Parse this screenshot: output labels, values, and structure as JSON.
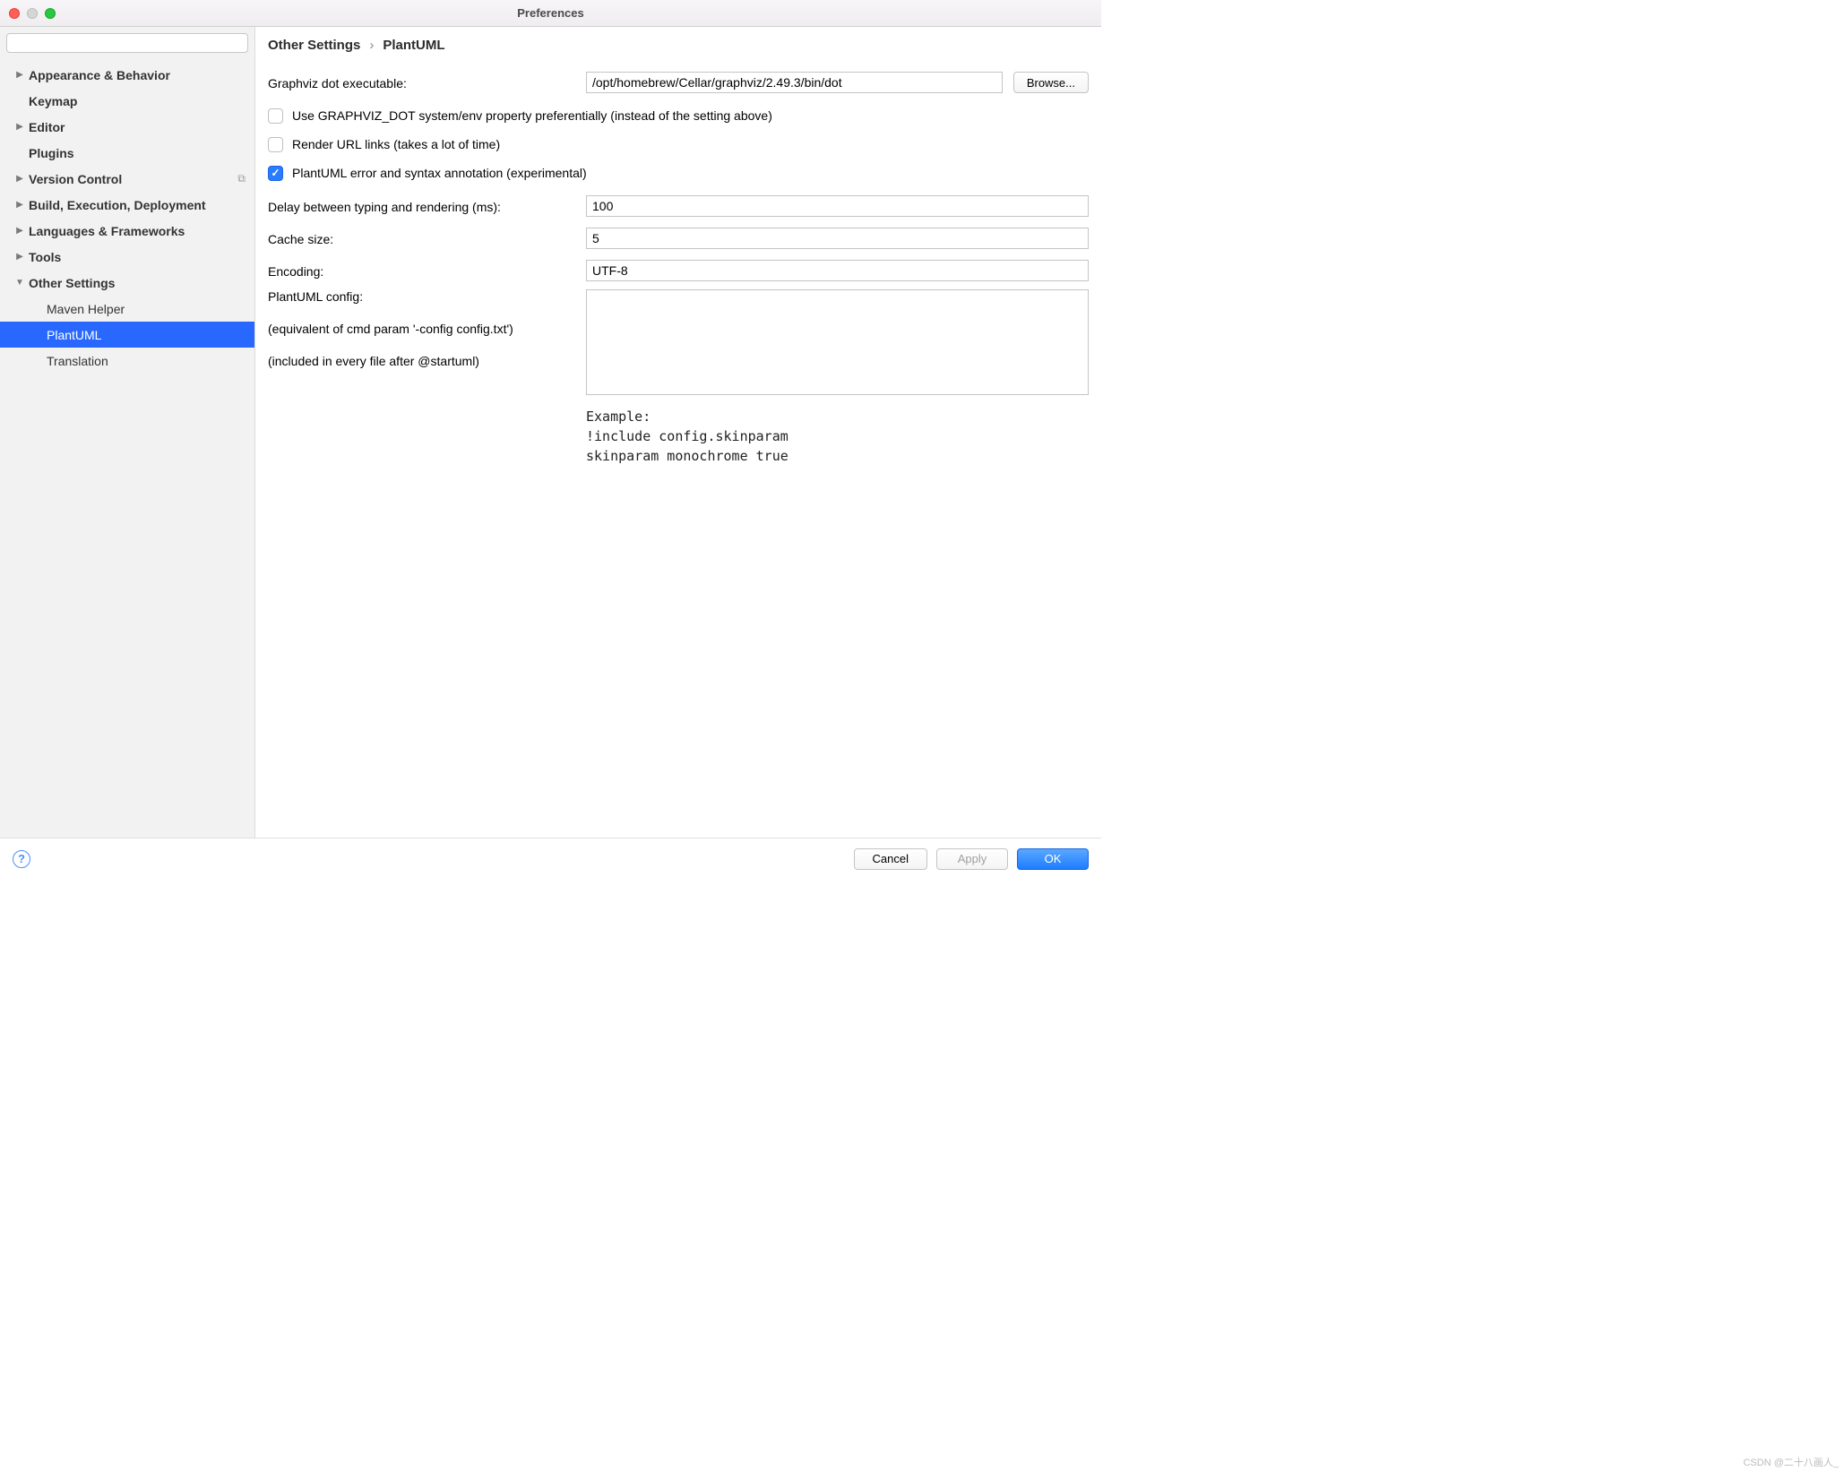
{
  "window": {
    "title": "Preferences"
  },
  "search": {
    "placeholder": ""
  },
  "sidebar": {
    "items": [
      {
        "label": "Appearance & Behavior",
        "expandable": true,
        "expanded": false
      },
      {
        "label": "Keymap",
        "expandable": false
      },
      {
        "label": "Editor",
        "expandable": true,
        "expanded": false
      },
      {
        "label": "Plugins",
        "expandable": false
      },
      {
        "label": "Version Control",
        "expandable": true,
        "expanded": false,
        "has_copy_icon": true
      },
      {
        "label": "Build, Execution, Deployment",
        "expandable": true,
        "expanded": false
      },
      {
        "label": "Languages & Frameworks",
        "expandable": true,
        "expanded": false
      },
      {
        "label": "Tools",
        "expandable": true,
        "expanded": false
      },
      {
        "label": "Other Settings",
        "expandable": true,
        "expanded": true,
        "children": [
          {
            "label": "Maven Helper"
          },
          {
            "label": "PlantUML",
            "selected": true
          },
          {
            "label": "Translation"
          }
        ]
      }
    ]
  },
  "breadcrumb": {
    "parent": "Other Settings",
    "current": "PlantUML"
  },
  "form": {
    "graphviz_label": "Graphviz dot executable:",
    "graphviz_value": "/opt/homebrew/Cellar/graphviz/2.49.3/bin/dot",
    "browse_label": "Browse...",
    "cb_use_env": "Use GRAPHVIZ_DOT system/env property preferentially (instead of the setting above)",
    "cb_render_url": "Render URL links (takes a lot of time)",
    "cb_syntax": "PlantUML error and syntax annotation (experimental)",
    "delay_label": "Delay between typing and rendering (ms):",
    "delay_value": "100",
    "cache_label": "Cache size:",
    "cache_value": "5",
    "encoding_label": "Encoding:",
    "encoding_value": "UTF-8",
    "config_label": "PlantUML config:",
    "config_sub1": "(equivalent of cmd param '-config config.txt')",
    "config_sub2": "(included in every file after @startuml)",
    "config_value": "",
    "example_text": "Example:\n!include config.skinparam\nskinparam monochrome true"
  },
  "footer": {
    "cancel": "Cancel",
    "apply": "Apply",
    "ok": "OK"
  },
  "watermark": "CSDN @二十八画人_"
}
